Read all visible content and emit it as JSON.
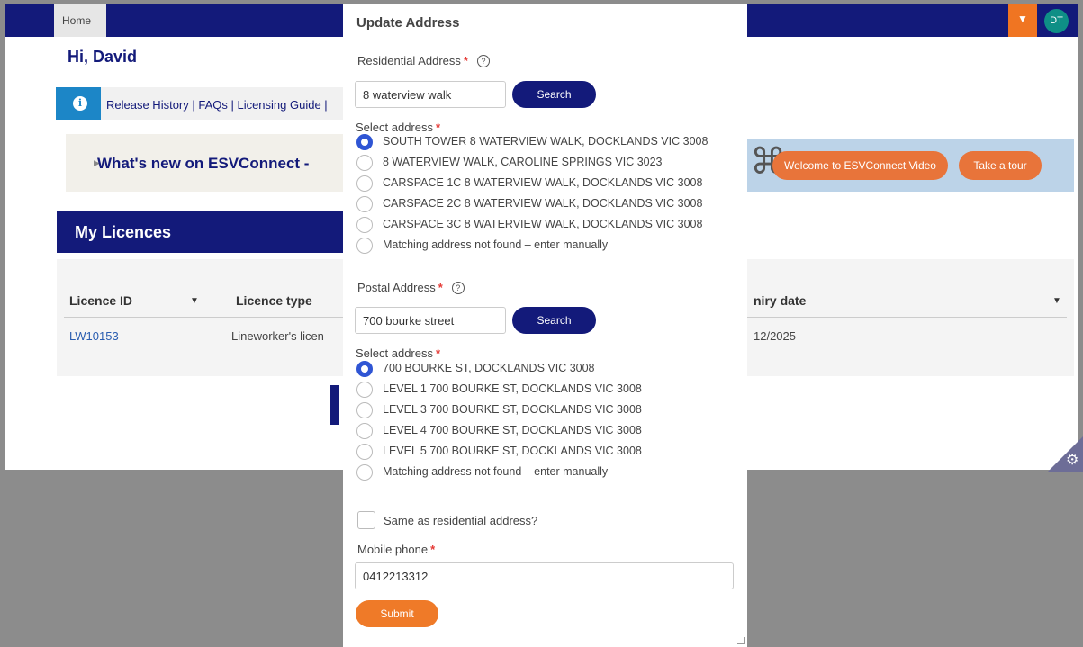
{
  "header": {
    "home_tab": "Home",
    "avatar_initials": "DT",
    "menu_caret": "▼",
    "accent_color": "#131a7a"
  },
  "greeting": "Hi, David",
  "info_bar": {
    "links_text": "Release History | FAQs | Licensing Guide |"
  },
  "whats_new": {
    "text": "What's new on ESVConnect -",
    "video_button": "Welcome to ESVConnect Video",
    "tour_button": "Take a tour"
  },
  "my_licences": {
    "title": "My Licences",
    "columns": [
      "Licence ID",
      "Licence type",
      "niry date"
    ],
    "rows": [
      {
        "id": "LW10153",
        "type": "Lineworker's licen",
        "expiry": "12/2025"
      }
    ]
  },
  "modal": {
    "title": "Update Address",
    "residential": {
      "label": "Residential Address",
      "input_value": "8 waterview walk",
      "search_label": "Search",
      "select_label": "Select address",
      "options": [
        "SOUTH TOWER 8 WATERVIEW WALK, DOCKLANDS VIC 3008",
        "8 WATERVIEW WALK, CAROLINE SPRINGS VIC 3023",
        "CARSPACE 1C 8 WATERVIEW WALK, DOCKLANDS VIC 3008",
        "CARSPACE 2C 8 WATERVIEW WALK, DOCKLANDS VIC 3008",
        "CARSPACE 3C 8 WATERVIEW WALK, DOCKLANDS VIC 3008",
        "Matching address not found – enter manually"
      ],
      "selected_index": 0
    },
    "postal": {
      "label": "Postal Address",
      "input_value": "700 bourke street",
      "search_label": "Search",
      "select_label": "Select address",
      "options": [
        "700 BOURKE ST, DOCKLANDS VIC 3008",
        "LEVEL 1 700 BOURKE ST, DOCKLANDS VIC 3008",
        "LEVEL 3 700 BOURKE ST, DOCKLANDS VIC 3008",
        "LEVEL 4 700 BOURKE ST, DOCKLANDS VIC 3008",
        "LEVEL 5 700 BOURKE ST, DOCKLANDS VIC 3008",
        "Matching address not found – enter manually"
      ],
      "selected_index": 0
    },
    "same_as_residential_label": "Same as residential address?",
    "mobile_phone": {
      "label": "Mobile phone",
      "value": "0412213312"
    },
    "required_mark": "*",
    "help_mark": "?",
    "submit_label": "Submit"
  }
}
